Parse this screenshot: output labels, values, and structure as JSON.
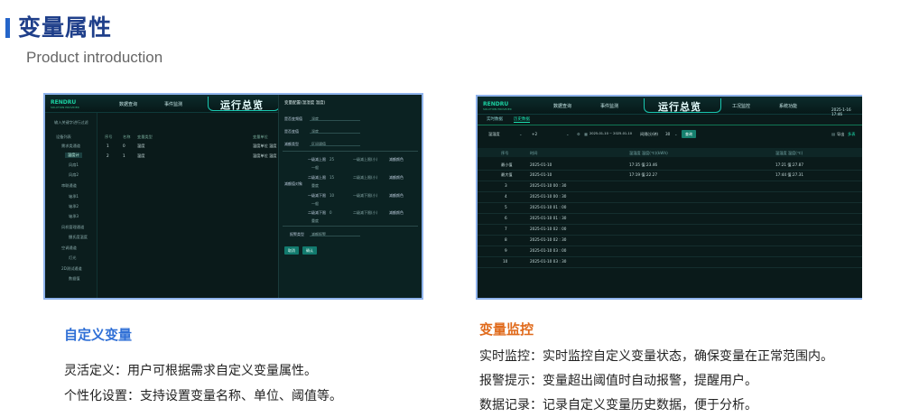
{
  "header": {
    "title": "变量属性",
    "subtitle": "Product introduction"
  },
  "left_screenshot": {
    "logo": "RENDRU",
    "logo_sub": "SOLUTION PROVIDER",
    "nav": [
      "数据查询",
      "事件监测"
    ],
    "center_title": "运行总览",
    "tree": [
      "输入关键字进行过滤",
      "设备列表",
      "需求类通道",
      "温度计",
      "风扇1",
      "风扇2",
      "串联通道",
      "轴承1",
      "轴承2",
      "轴承3",
      "风机管理通道",
      "摄氏度温度",
      "空调通道",
      "灯光",
      "2D测试通道",
      "数据值"
    ],
    "table_head": [
      "序号",
      "名称",
      "变量类型",
      "变量单位"
    ],
    "table_rows": [
      [
        "1",
        "0",
        "温度",
        "温度单位 温度"
      ],
      [
        "2",
        "1",
        "温度",
        "温度单位 温度"
      ]
    ],
    "form": {
      "title": "变量配置(温湿度 温度)",
      "rows": [
        {
          "label": "是否变频值",
          "value": "温度"
        },
        {
          "label": "是否变值",
          "value": "温度"
        },
        {
          "label": "减额类型",
          "value": "区间阈值"
        }
      ],
      "threshold_label": "减额值对象",
      "thresholds": [
        {
          "label": "一级减上限",
          "value": "25",
          "a": "一级减上限(小)",
          "b": "减额颜色"
        },
        {
          "label": "二级减上限",
          "value": "15",
          "a": "二级减上限(小)",
          "b": "减额颜色"
        },
        {
          "label": "一级减下限",
          "value": "10",
          "a": "一级减下限(小)",
          "b": "减额颜色"
        },
        {
          "label": "二级减下限",
          "value": "0",
          "a": "二级减下限(小)",
          "b": "减额颜色"
        }
      ],
      "sub_values": [
        "一般",
        "重度",
        "一般",
        "重度"
      ],
      "alarm_label": "报警类型",
      "alarm_value": "减额报警",
      "cancel": "取消",
      "confirm": "确认"
    }
  },
  "right_screenshot": {
    "logo": "RENDRU",
    "logo_sub": "SOLUTION PROVIDER",
    "nav": [
      "数据查询",
      "事件监测",
      "工况监控",
      "系统功能"
    ],
    "center_title": "运行总览",
    "datetime": "2025-1-16 17:46",
    "tabs": [
      "实时数据",
      "历史数据"
    ],
    "filter": {
      "select1": "温湿度",
      "select2": "+2",
      "date_range": "2025-01-10 ~ 2025-01-10",
      "interval_label": "间隔(分钟)",
      "interval_value": "30",
      "query": "查询",
      "right_action": "导出",
      "right_action2": "多表"
    },
    "columns": [
      "序号",
      "时间",
      "温湿度 温度(℃)(kWh)",
      "温湿度 温度(℃)"
    ],
    "rows": [
      [
        "最小值",
        "2025-01-10",
        "17:35 值:23.46",
        "17:21 值:27.87"
      ],
      [
        "最大值",
        "2025-01-10",
        "17:19 值:22.27",
        "17:44 值:27.31"
      ],
      [
        "3",
        "2025-01-10 00 : 30",
        "",
        ""
      ],
      [
        "4",
        "2025-01-10 00 : 30",
        "",
        ""
      ],
      [
        "5",
        "2025-01-10 01 : 00",
        "",
        ""
      ],
      [
        "6",
        "2025-01-10 01 : 30",
        "",
        ""
      ],
      [
        "7",
        "2025-01-10 02 : 00",
        "",
        ""
      ],
      [
        "8",
        "2025-01-10 02 : 30",
        "",
        ""
      ],
      [
        "9",
        "2025-01-10 03 : 00",
        "",
        ""
      ],
      [
        "10",
        "2025-01-10 03 : 30",
        "",
        ""
      ]
    ]
  },
  "features_left": {
    "title": "自定义变量",
    "title_color": "#2f6fd6",
    "lines": [
      "灵活定义：用户可根据需求自定义变量属性。",
      "个性化设置：支持设置变量名称、单位、阈值等。"
    ]
  },
  "features_right": {
    "title": "变量监控",
    "title_color": "#e06a1b",
    "lines": [
      "实时监控：实时监控自定义变量状态，确保变量在正常范围内。",
      "报警提示：变量超出阈值时自动报警，提醒用户。",
      "数据记录：记录自定义变量历史数据，便于分析。"
    ]
  }
}
